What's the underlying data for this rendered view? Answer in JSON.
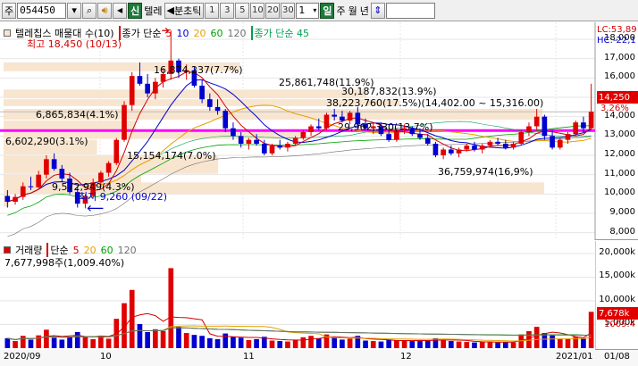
{
  "toolbar": {
    "mode_label": "주",
    "stock_code": "054450",
    "speaker_label": "◀",
    "shin_label": "신",
    "stock_name": "텔레",
    "period_label": "분초틱",
    "cycles": [
      "1",
      "3",
      "5",
      "10",
      "20",
      "30"
    ],
    "cycle_value": "1",
    "daily_label": "일",
    "weekly_label": "주",
    "monthly_label": "월",
    "yearly_label": "년"
  },
  "legend": {
    "name": "텔레칩스 매물대 수(10)",
    "close_ma": "종가 단순",
    "ma_periods": [
      "5",
      "10",
      "20",
      "60",
      "120"
    ],
    "close_ma2": "종가 단순 45"
  },
  "colors": {
    "ma5": "#d40000",
    "ma10": "#0000d0",
    "ma20": "#e8a000",
    "ma60": "#00a000",
    "ma120": "#707070",
    "ma45": "#00a050",
    "up": "#e00000",
    "down": "#0000d0",
    "band": "#f8e5d0",
    "magenta": "#ff00ff"
  },
  "annotations": {
    "max": "최고 18,450 (10/13)",
    "min": "최저 9,260 (09/22)",
    "bands": [
      "16,874,237(7.7%)",
      "25,861,748(11.9%)",
      "30,187,832(13.9%)",
      "38,223,760(17.5%)(14,402.00 ~ 15,316.00)",
      "6,865,834(4.1%)",
      "29,962,330(13.7%)",
      "6,602,290(3.1%)",
      "15,154,174(7.0%)",
      "9,572,949(4.3%)",
      "36,759,974(16,9%)"
    ]
  },
  "price_axis": [
    "18,000",
    "17,000",
    "16,000",
    "15,000",
    "14,000",
    "13,000",
    "12,000",
    "11,000",
    "10,000",
    "9,000",
    "8,000"
  ],
  "right_info": {
    "lc": "LC:53,89",
    "hc": "HC:-22,1",
    "last_price": "14,250",
    "change": "3.26%"
  },
  "volume": {
    "legend_name": "거래량",
    "legend_ma": "단순",
    "ma_periods": [
      "5",
      "20",
      "60",
      "120"
    ],
    "current": "7,677,998주(1,009.40%)",
    "axis": [
      "20,000k",
      "15,000k",
      "10,000k",
      "5,000k"
    ],
    "last_box": "7,678k",
    "ratio_box": "1009.4"
  },
  "dates": [
    "2020/09",
    "10",
    "11",
    "12",
    "2021/01",
    "01/08"
  ],
  "chart_data": {
    "type": "candlestick",
    "x": [
      "2020/09",
      "10",
      "11",
      "12",
      "2021/01"
    ],
    "ylim": [
      7800,
      18600
    ],
    "max": {
      "value": 18450,
      "date": "10/13"
    },
    "min": {
      "value": 9260,
      "date": "09/22"
    },
    "ohlc": [
      [
        9900,
        10200,
        9300,
        9600
      ],
      [
        9600,
        10000,
        9450,
        9850
      ],
      [
        9850,
        10600,
        9700,
        10400
      ],
      [
        10400,
        10900,
        10200,
        10350
      ],
      [
        10350,
        11200,
        10300,
        11000
      ],
      [
        11000,
        12000,
        10800,
        11800
      ],
      [
        11800,
        12100,
        11200,
        11300
      ],
      [
        11300,
        11500,
        10600,
        10800
      ],
      [
        10800,
        11100,
        10000,
        10100
      ],
      [
        10100,
        10400,
        9300,
        9500
      ],
      [
        9500,
        10000,
        9260,
        9900
      ],
      [
        9900,
        10800,
        9800,
        10600
      ],
      [
        10600,
        11200,
        10400,
        11100
      ],
      [
        11100,
        11700,
        10900,
        11600
      ],
      [
        11600,
        12900,
        11500,
        12800
      ],
      [
        12800,
        14800,
        12700,
        14600
      ],
      [
        14600,
        16300,
        14300,
        16100
      ],
      [
        16100,
        16800,
        15600,
        15700
      ],
      [
        15700,
        16200,
        15000,
        15200
      ],
      [
        15200,
        16000,
        14900,
        15800
      ],
      [
        15800,
        16500,
        15500,
        16200
      ],
      [
        16200,
        18450,
        15900,
        16900
      ],
      [
        16900,
        17000,
        16000,
        16300
      ],
      [
        16300,
        16700,
        15900,
        16400
      ],
      [
        16400,
        16600,
        15500,
        15600
      ],
      [
        15600,
        15900,
        14700,
        14900
      ],
      [
        14900,
        15200,
        14300,
        14500
      ],
      [
        14500,
        14900,
        14100,
        14300
      ],
      [
        14300,
        14400,
        13200,
        13400
      ],
      [
        13400,
        13700,
        12800,
        13000
      ],
      [
        13000,
        13200,
        12400,
        12600
      ],
      [
        12600,
        12900,
        12300,
        12800
      ],
      [
        12800,
        13100,
        12500,
        12600
      ],
      [
        12600,
        12800,
        12000,
        12100
      ],
      [
        12100,
        12600,
        12000,
        12500
      ],
      [
        12500,
        12800,
        12300,
        12400
      ],
      [
        12400,
        12700,
        12200,
        12600
      ],
      [
        12600,
        13000,
        12500,
        12900
      ],
      [
        12900,
        13300,
        12800,
        13200
      ],
      [
        13200,
        13600,
        13000,
        13500
      ],
      [
        13500,
        13900,
        13300,
        13400
      ],
      [
        13400,
        14200,
        13300,
        14100
      ],
      [
        14100,
        14400,
        13800,
        14000
      ],
      [
        14000,
        14300,
        13700,
        13800
      ],
      [
        13800,
        14300,
        13600,
        14200
      ],
      [
        14200,
        14500,
        13400,
        13600
      ],
      [
        13600,
        13900,
        13300,
        13400
      ],
      [
        13400,
        13700,
        13100,
        13500
      ],
      [
        13500,
        13700,
        13000,
        13100
      ],
      [
        13100,
        13300,
        12700,
        12800
      ],
      [
        12800,
        13400,
        12700,
        13300
      ],
      [
        13300,
        13600,
        13100,
        13400
      ],
      [
        13400,
        13500,
        13000,
        13100
      ],
      [
        13100,
        13400,
        12800,
        12900
      ],
      [
        12900,
        13100,
        12500,
        12600
      ],
      [
        12600,
        12700,
        11900,
        12000
      ],
      [
        12000,
        12400,
        11800,
        12300
      ],
      [
        12300,
        12500,
        12000,
        12100
      ],
      [
        12100,
        12400,
        11900,
        12300
      ],
      [
        12300,
        12600,
        12200,
        12500
      ],
      [
        12500,
        12700,
        12200,
        12300
      ],
      [
        12300,
        12600,
        12100,
        12500
      ],
      [
        12500,
        12800,
        12400,
        12700
      ],
      [
        12700,
        12900,
        12500,
        12600
      ],
      [
        12600,
        12800,
        12300,
        12400
      ],
      [
        12400,
        12700,
        12300,
        12600
      ],
      [
        12600,
        13300,
        12500,
        13200
      ],
      [
        13200,
        13700,
        13000,
        13500
      ],
      [
        13500,
        14400,
        13300,
        14000
      ],
      [
        14000,
        14100,
        12800,
        13000
      ],
      [
        13000,
        13300,
        12300,
        12400
      ],
      [
        12400,
        12900,
        12300,
        12800
      ],
      [
        12800,
        13200,
        12600,
        13100
      ],
      [
        13100,
        13800,
        13000,
        13700
      ],
      [
        13700,
        14000,
        13200,
        13400
      ],
      [
        13400,
        15700,
        13300,
        14250
      ]
    ],
    "volume": [
      2100,
      1500,
      2600,
      1800,
      2700,
      3900,
      2200,
      1800,
      2400,
      3400,
      2500,
      1900,
      2600,
      2000,
      6200,
      9500,
      12300,
      5100,
      3400,
      4000,
      3600,
      16900,
      4500,
      3200,
      2800,
      2600,
      2100,
      1900,
      3100,
      2400,
      2200,
      1700,
      1900,
      2400,
      1600,
      1500,
      1400,
      1700,
      2300,
      2600,
      2100,
      2900,
      2200,
      1800,
      2000,
      2600,
      1600,
      1500,
      1400,
      1800,
      1700,
      1600,
      1500,
      1500,
      1700,
      2100,
      1800,
      1500,
      1400,
      1300,
      1200,
      1300,
      1400,
      1200,
      1300,
      1200,
      2900,
      3600,
      4500,
      3200,
      2700,
      2000,
      1900,
      2400,
      2000,
      7678
    ],
    "series_ma": [
      "5",
      "10",
      "20",
      "60",
      "120",
      "45"
    ]
  }
}
